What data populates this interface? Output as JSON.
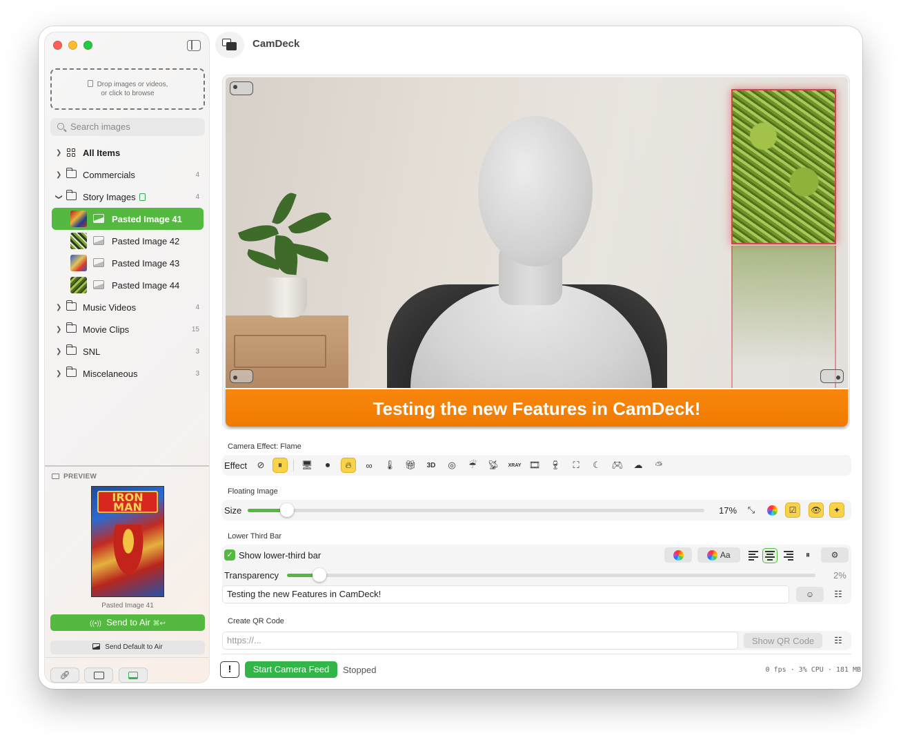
{
  "app": {
    "title": "CamDeck"
  },
  "sidebar": {
    "dropzone_line1": "Drop images or videos,",
    "dropzone_line2": "or click to browse",
    "search_placeholder": "Search images",
    "all_items": "All Items",
    "folders": [
      {
        "label": "Commercials",
        "count": "4"
      },
      {
        "label": "Story Images",
        "count": "4"
      },
      {
        "label": "Music Videos",
        "count": "4"
      },
      {
        "label": "Movie Clips",
        "count": "15"
      },
      {
        "label": "SNL",
        "count": "3"
      },
      {
        "label": "Miscelaneous",
        "count": "3"
      }
    ],
    "story_children": [
      {
        "label": "Pasted Image 41"
      },
      {
        "label": "Pasted Image 42"
      },
      {
        "label": "Pasted Image 43"
      },
      {
        "label": "Pasted Image 44"
      }
    ],
    "preview": {
      "header": "PREVIEW",
      "cover_logo": "IRON MAN",
      "caption": "Pasted Image 41"
    },
    "send_air": "Send to Air",
    "send_air_shortcut": "⌘↩",
    "send_default": "Send Default to Air"
  },
  "stage": {
    "lower_third_text": "Testing the new Features in CamDeck!"
  },
  "camera_effect": {
    "header": "Camera Effect: Flame",
    "effect_label": "Effect",
    "label_3d": "3D",
    "label_xray": "XRAY"
  },
  "floating_image": {
    "header": "Floating Image",
    "size_label": "Size",
    "size_value": "17%",
    "size_fraction": 0.05
  },
  "lower_third": {
    "header": "Lower Third Bar",
    "show_label": "Show lower-third bar",
    "font_button": "Aa",
    "transparency_label": "Transparency",
    "transparency_value": "2%",
    "transparency_fraction": 0.03,
    "text_value": "Testing the new Features in CamDeck!"
  },
  "qr": {
    "header": "Create QR Code",
    "url_placeholder": "https://...",
    "show_button": "Show QR Code"
  },
  "statusbar": {
    "alert": "!",
    "start_button": "Start Camera Feed",
    "status": "Stopped",
    "stats": "0 fps · 3% CPU · 181 MB"
  },
  "colors": {
    "accent_green": "#55b941",
    "lower_third_orange": "#f07a00",
    "toggle_yellow": "#f8d248"
  }
}
